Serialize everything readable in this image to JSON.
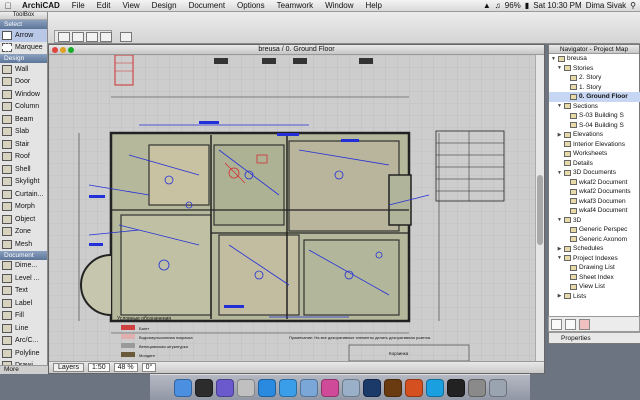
{
  "menubar": {
    "items": [
      "ArchiCAD",
      "File",
      "Edit",
      "View",
      "Design",
      "Document",
      "Options",
      "Teamwork",
      "Window",
      "Help"
    ],
    "battery": "96%",
    "clock": "Sat 10:30 PM",
    "user": "Dima Sivak"
  },
  "toolbox": {
    "title": "ToolBox",
    "select_section": "Select",
    "select_tools": [
      "Arrow",
      "Marquee"
    ],
    "design_section": "Design",
    "design_tools": [
      "Wall",
      "Door",
      "Window",
      "Column",
      "Beam",
      "Slab",
      "Stair",
      "Roof",
      "Shell",
      "Skylight",
      "Curtain...",
      "Morph",
      "Object",
      "Zone",
      "Mesh"
    ],
    "document_section": "Document",
    "document_tools": [
      "Dime...",
      "Level ...",
      "Text",
      "Label",
      "Fill",
      "Line",
      "Arc/C...",
      "Polyline",
      "Drawi..."
    ],
    "more": "More"
  },
  "window": {
    "title": "breusa / 0. Ground Floor",
    "layers_button": "Layers",
    "scale": "1:50",
    "zoom": "48 %",
    "angle": "0°"
  },
  "drawing": {
    "legend_title": "Условные обозначения",
    "legend_items": [
      "Багет",
      "Водоэмульсионная покраска",
      "Венецианская штукатурка",
      "Молдинг"
    ],
    "note": "Примечание: На все декоративные элементы делать декоративная розетка.",
    "stamp": "Корзинка"
  },
  "navigator": {
    "title": "Navigator - Project Map",
    "tree": [
      {
        "label": "breusa",
        "level": 0,
        "arrow": "▼"
      },
      {
        "label": "Stories",
        "level": 1,
        "arrow": "▼"
      },
      {
        "label": "2. Story",
        "level": 2,
        "arrow": ""
      },
      {
        "label": "1. Story",
        "level": 2,
        "arrow": ""
      },
      {
        "label": "0. Ground Floor",
        "level": 2,
        "arrow": "",
        "selected": true
      },
      {
        "label": "Sections",
        "level": 1,
        "arrow": "▼"
      },
      {
        "label": "S-03 Building S",
        "level": 2,
        "arrow": ""
      },
      {
        "label": "S-04 Building S",
        "level": 2,
        "arrow": ""
      },
      {
        "label": "Elevations",
        "level": 1,
        "arrow": "▶"
      },
      {
        "label": "Interior Elevations",
        "level": 1,
        "arrow": ""
      },
      {
        "label": "Worksheets",
        "level": 1,
        "arrow": ""
      },
      {
        "label": "Details",
        "level": 1,
        "arrow": ""
      },
      {
        "label": "3D Documents",
        "level": 1,
        "arrow": "▼"
      },
      {
        "label": "wkaf2 Document",
        "level": 2,
        "arrow": ""
      },
      {
        "label": "wkaf2 Documents",
        "level": 2,
        "arrow": ""
      },
      {
        "label": "wkaf3 Documen",
        "level": 2,
        "arrow": ""
      },
      {
        "label": "wkaf4 Document",
        "level": 2,
        "arrow": ""
      },
      {
        "label": "3D",
        "level": 1,
        "arrow": "▼"
      },
      {
        "label": "Generic Perspec",
        "level": 2,
        "arrow": ""
      },
      {
        "label": "Generic Axonom",
        "level": 2,
        "arrow": ""
      },
      {
        "label": "Schedules",
        "level": 1,
        "arrow": "▶"
      },
      {
        "label": "Project Indexes",
        "level": 1,
        "arrow": "▼"
      },
      {
        "label": "Drawing List",
        "level": 2,
        "arrow": ""
      },
      {
        "label": "Sheet Index",
        "level": 2,
        "arrow": ""
      },
      {
        "label": "View List",
        "level": 2,
        "arrow": ""
      },
      {
        "label": "Lists",
        "level": 1,
        "arrow": "▶"
      }
    ],
    "properties": "Properties"
  },
  "dock": {
    "apps": [
      "finder",
      "dashboard",
      "mission-control",
      "launchpad",
      "app-store",
      "safari",
      "mail",
      "itunes",
      "preview",
      "photoshop",
      "illustrator",
      "archicad",
      "skype",
      "terminal",
      "system-preferences",
      "trash"
    ],
    "colors": [
      "#4a8fe0",
      "#2c2c2c",
      "#6a5acd",
      "#c0c0c0",
      "#2a8ae0",
      "#3a9ee8",
      "#7aa7d8",
      "#d04a9a",
      "#9ab0c8",
      "#1b3a6a",
      "#6a3a10",
      "#d45020",
      "#1aa0e0",
      "#222222",
      "#8a8a8a",
      "#9aa4b0"
    ]
  }
}
